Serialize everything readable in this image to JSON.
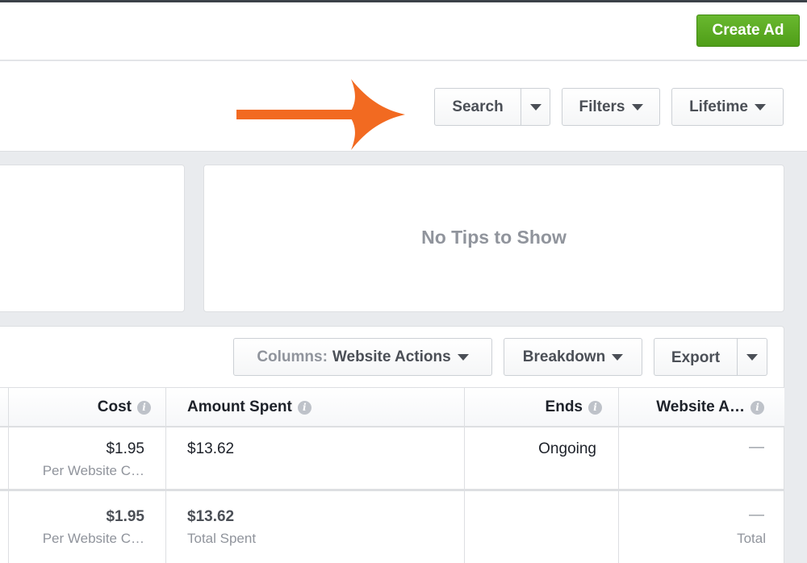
{
  "topbar": {
    "create_ad_label": "Create Ad"
  },
  "toolbar": {
    "search_label": "Search",
    "filters_label": "Filters",
    "lifetime_label": "Lifetime"
  },
  "tips": {
    "empty_text": "No Tips to Show"
  },
  "table_toolbar": {
    "columns_prefix": "Columns:",
    "columns_value": "Website Actions",
    "breakdown_label": "Breakdown",
    "export_label": "Export"
  },
  "table": {
    "headers": {
      "cost": "Cost",
      "amount_spent": "Amount Spent",
      "ends": "Ends",
      "website_actions": "Website A…"
    },
    "rows": [
      {
        "cost": "$1.95",
        "cost_sub": "Per Website C…",
        "amount_spent": "$13.62",
        "ends": "Ongoing",
        "website_actions": "—"
      }
    ],
    "totals": {
      "cost": "$1.95",
      "cost_sub": "Per Website C…",
      "amount_spent": "$13.62",
      "amount_sub": "Total Spent",
      "website_actions": "—",
      "website_actions_sub": "Total"
    }
  },
  "colors": {
    "accent_green": "#4f9e18",
    "arrow_orange": "#f26a21",
    "muted_text": "#90949c"
  }
}
